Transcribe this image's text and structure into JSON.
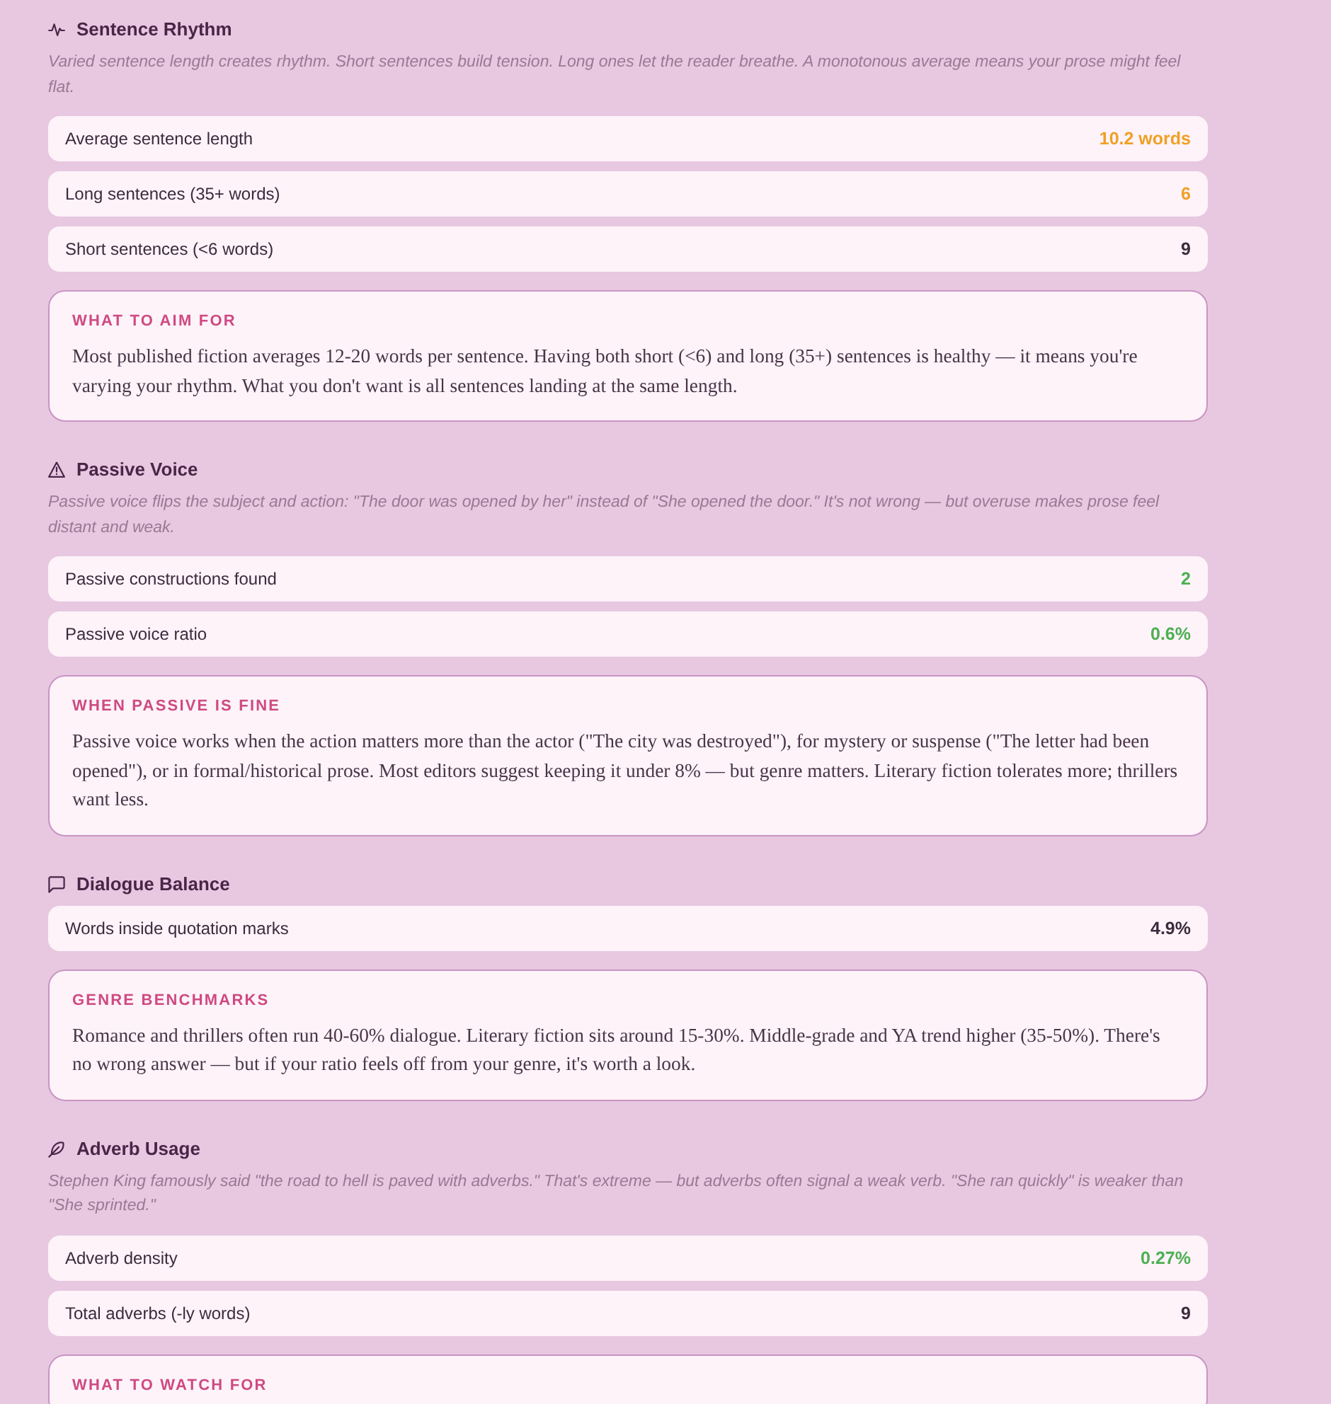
{
  "sections": [
    {
      "kind": "pulse",
      "title": "Sentence Rhythm",
      "description": "Varied sentence length creates rhythm. Short sentences build tension. Long ones let the reader breathe. A monotonous average means your prose might feel flat.",
      "metrics": [
        {
          "label": "Average sentence length",
          "value": "10.2 words",
          "color": "#f0a024"
        },
        {
          "label": "Long sentences (35+ words)",
          "value": "6",
          "color": "#f0a024"
        },
        {
          "label": "Short sentences (<6 words)",
          "value": "9",
          "color": "#3d2a3d"
        }
      ],
      "note": {
        "title": "WHAT TO AIM FOR",
        "body": "Most published fiction averages 12-20 words per sentence. Having both short (<6) and long (35+) sentences is healthy — it means you're varying your rhythm. What you don't want is all sentences landing at the same length."
      }
    },
    {
      "kind": "warning",
      "title": "Passive Voice",
      "description": "Passive voice flips the subject and action: \"The door was opened by her\" instead of \"She opened the door.\" It's not wrong — but overuse makes prose feel distant and weak.",
      "metrics": [
        {
          "label": "Passive constructions found",
          "value": "2",
          "color": "#4caf50"
        },
        {
          "label": "Passive voice ratio",
          "value": "0.6%",
          "color": "#4caf50"
        }
      ],
      "note": {
        "title": "WHEN PASSIVE IS FINE",
        "body": "Passive voice works when the action matters more than the actor (\"The city was destroyed\"), for mystery or suspense (\"The letter had been opened\"), or in formal/historical prose. Most editors suggest keeping it under 8% — but genre matters. Literary fiction tolerates more; thrillers want less."
      }
    },
    {
      "kind": "chat",
      "title": "Dialogue Balance",
      "metrics": [
        {
          "label": "Words inside quotation marks",
          "value": "4.9%",
          "color": "#3d2a3d"
        }
      ],
      "note": {
        "title": "GENRE BENCHMARKS",
        "body": "Romance and thrillers often run 40-60% dialogue. Literary fiction sits around 15-30%. Middle-grade and YA trend higher (35-50%). There's no wrong answer — but if your ratio feels off from your genre, it's worth a look."
      }
    },
    {
      "kind": "feather",
      "title": "Adverb Usage",
      "description": "Stephen King famously said \"the road to hell is paved with adverbs.\" That's extreme — but adverbs often signal a weak verb. \"She ran quickly\" is weaker than \"She sprinted.\"",
      "metrics": [
        {
          "label": "Adverb density",
          "value": "0.27%",
          "color": "#4caf50"
        },
        {
          "label": "Total adverbs (-ly words)",
          "value": "9",
          "color": "#3d2a3d"
        }
      ],
      "note": {
        "title": "WHAT TO WATCH FOR"
      }
    }
  ]
}
